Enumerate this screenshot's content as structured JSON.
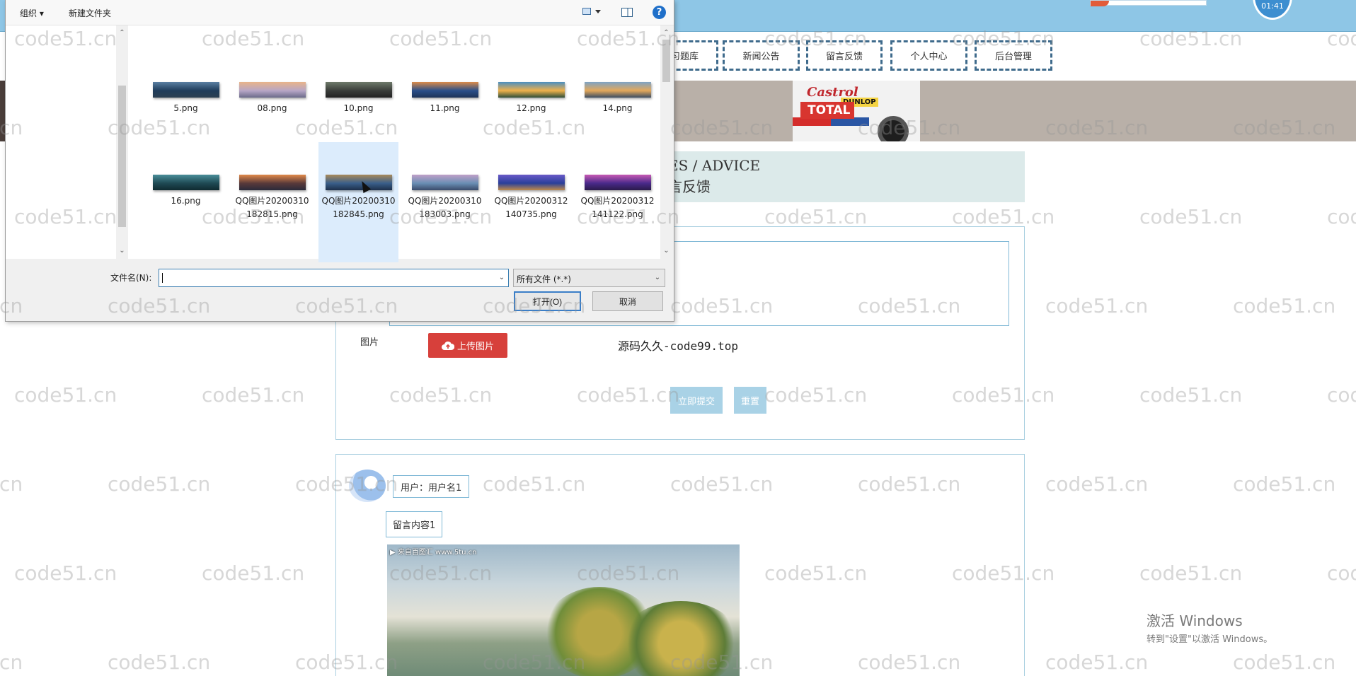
{
  "site": {
    "clock_text": "01:41",
    "nav": [
      {
        "label": "习题库"
      },
      {
        "label": "新闻公告"
      },
      {
        "label": "留言反馈"
      },
      {
        "label": "个人中心"
      },
      {
        "label": "后台管理"
      }
    ],
    "banner_brands": [
      "Castrol",
      "DUNLOP",
      "TOTAL"
    ],
    "section_title_en": "ES / ADVICE",
    "section_title_zh": "言反馈",
    "form": {
      "image_label": "图片",
      "upload_button": "上传图片",
      "promo_text": "源码久久-code99.top",
      "submit_button": "立即提交",
      "reset_button": "重置"
    },
    "message": {
      "user_label": "用户：用户名1",
      "content": "留言内容1",
      "image_caption": "▶ 来自百图汇 www.5tu.cn"
    },
    "activation": {
      "line1": "激活 Windows",
      "line2": "转到\"设置\"以激活 Windows。"
    }
  },
  "watermark": "code51.cn",
  "dialog": {
    "toolbar": {
      "organize_label": "组织 ▾",
      "new_folder_label": "新建文件夹",
      "help_label": "?"
    },
    "files": [
      {
        "name": "5.png",
        "colors": [
          "#1f3c5a",
          "#5a7fa2",
          "#2b3f52"
        ]
      },
      {
        "name": "08.png",
        "colors": [
          "#b7a6c6",
          "#e8b48a",
          "#6b6b8a"
        ]
      },
      {
        "name": "10.png",
        "colors": [
          "#3a3d3a",
          "#6e7a6a",
          "#222"
        ]
      },
      {
        "name": "11.png",
        "colors": [
          "#2a4f8a",
          "#d98b4a",
          "#1d3358"
        ]
      },
      {
        "name": "12.png",
        "colors": [
          "#f0b14a",
          "#4c8fc0",
          "#2d4e3a"
        ]
      },
      {
        "name": "14.png",
        "colors": [
          "#e4a85a",
          "#7ea3c4",
          "#3a4d63"
        ]
      },
      {
        "name": "16.png",
        "colors": [
          "#1f4a54",
          "#4a8f9a",
          "#0f2a30"
        ]
      },
      {
        "name": "QQ图片20200310182815.png",
        "colors": [
          "#5a3a3a",
          "#e28a4a",
          "#2a2a3a"
        ]
      },
      {
        "name": "QQ图片20200310182845.png",
        "colors": [
          "#3a5f8a",
          "#a98a5a",
          "#1d2f4a"
        ]
      },
      {
        "name": "QQ图片20200310183003.png",
        "colors": [
          "#6a8fb4",
          "#c0a0c8",
          "#3a4a6a"
        ]
      },
      {
        "name": "QQ图片20200312140735.png",
        "colors": [
          "#2a3f9a",
          "#6a5ac8",
          "#c08a4a"
        ]
      },
      {
        "name": "QQ图片20200312141122.png",
        "colors": [
          "#4a2a8a",
          "#c85ab4",
          "#2a1a4a"
        ]
      }
    ],
    "filename_label": "文件名(N):",
    "filename_value": "",
    "filter_label": "所有文件 (*.*)",
    "open_button": "打开(O)",
    "cancel_button": "取消"
  }
}
